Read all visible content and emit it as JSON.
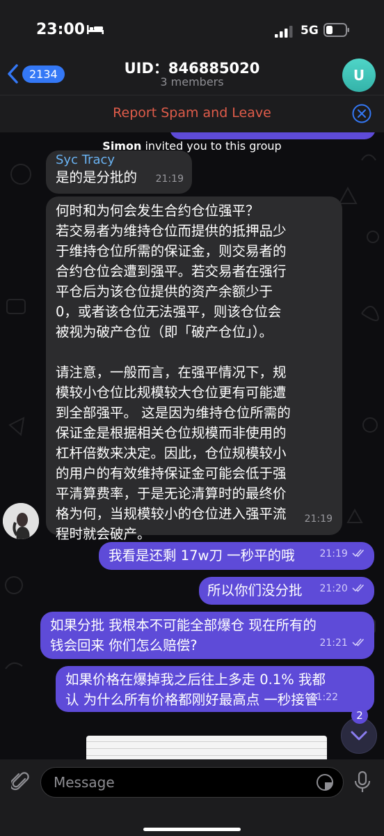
{
  "status_bar": {
    "time": "23:00",
    "network": "5G",
    "icons": [
      "bed-icon",
      "signal-icon",
      "battery-icon"
    ]
  },
  "header": {
    "back_count": "2134",
    "title": "UID：846885020",
    "subtitle": "3 members",
    "avatar_letter": "U"
  },
  "spam_bar": {
    "label": "Report Spam and Leave"
  },
  "service": {
    "inviter": "Simon",
    "text": " invited you to this group"
  },
  "messages": [
    {
      "sender": "Syc Tracy",
      "lines": [
        "是的是分批的"
      ],
      "time": "21:19"
    },
    {
      "lines": [
        "何时和为何会发生合约仓位强平？",
        "若交易者为维持仓位而提供的抵押品少",
        "于维持仓位所需的保证金，则交易者的",
        "合约仓位会遭到强平。若交易者在强行",
        "平仓后为该仓位提供的资产余额少于",
        "0，或者该仓位无法强平，则该仓位会",
        "被视为破产仓位（即「破产仓位」）。",
        "",
        "请注意，一般而言，在强平情况下，规",
        "模较小仓位比规模较大仓位更有可能遭",
        "到全部强平。 这是因为维持仓位所需的",
        "保证金是根据相关仓位规模而非使用的",
        "杠杆倍数来决定。因此，仓位规模较小",
        "的用户的有效维持保证金可能会低于强",
        "平清算费率，于是无论清算时的最终价",
        "格为何，当规模较小的仓位进入强平流",
        "程时就会破产。"
      ],
      "time": "21:19"
    },
    {
      "lines": [
        "我看是还剩 17w刀 一秒平的哦"
      ],
      "time": "21:19"
    },
    {
      "lines": [
        "所以你们没分批"
      ],
      "time": "21:20"
    },
    {
      "lines": [
        "如果分批 我根本不可能全部爆仓 现在所有的",
        "钱会回来 你们怎么赔偿?"
      ],
      "time": "21:21"
    },
    {
      "lines": [
        "如果价格在爆掉我之后往上多走 0.1% 我都",
        "认 为什么所有价格都刚好最高点 一秒接管"
      ],
      "time": "21:22"
    }
  ],
  "unread": {
    "count": "2"
  },
  "input": {
    "placeholder": "Message"
  },
  "colors": {
    "accent": "#3478f6",
    "outgoing_bubble": "#5e4bd8",
    "incoming_bubble": "#2c2c2e",
    "spam": "#e05c4a",
    "sender": "#6ab3f3"
  }
}
